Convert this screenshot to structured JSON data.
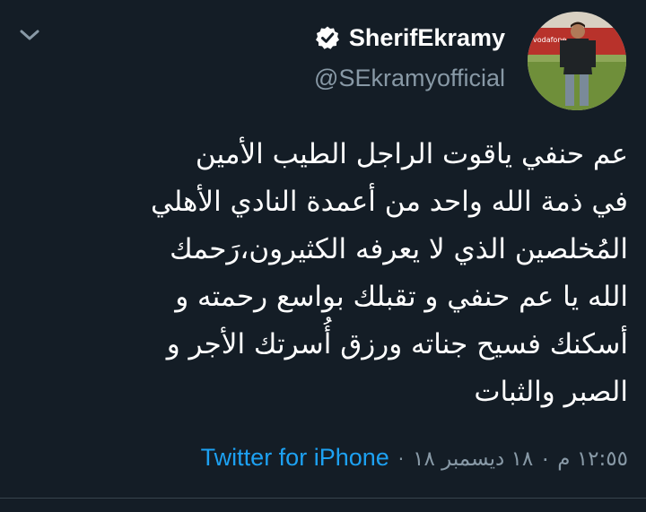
{
  "user": {
    "display_name": "SherifEkramy",
    "handle": "@SEkramyofficial",
    "verified": true
  },
  "tweet": {
    "lines": [
      "عم حنفي ياقوت الراجل الطيب الأمين",
      "في ذمة الله واحد من أعمدة النادي الأهلي",
      "المُخلصين الذي لا يعرفه الكثيرون،رَحمك",
      "الله يا عم حنفي و تقبلك بواسع رحمته و",
      "أسكنك فسيح جناته ورزق أُسرتك الأجر و",
      "الصبر والثبات"
    ],
    "timestamp": "١٢:٥٥ م ٠ ١٨ ديسمبر ١٨",
    "separator": "·",
    "source": "Twitter for iPhone"
  },
  "icons": {
    "menu": "chevron-down-icon",
    "verified": "verified-badge-icon",
    "avatar": "profile-avatar"
  },
  "colors": {
    "background": "#141d26",
    "text": "#ffffff",
    "secondary": "#8899a6",
    "accent": "#1da1f2",
    "divider": "#38444d"
  }
}
